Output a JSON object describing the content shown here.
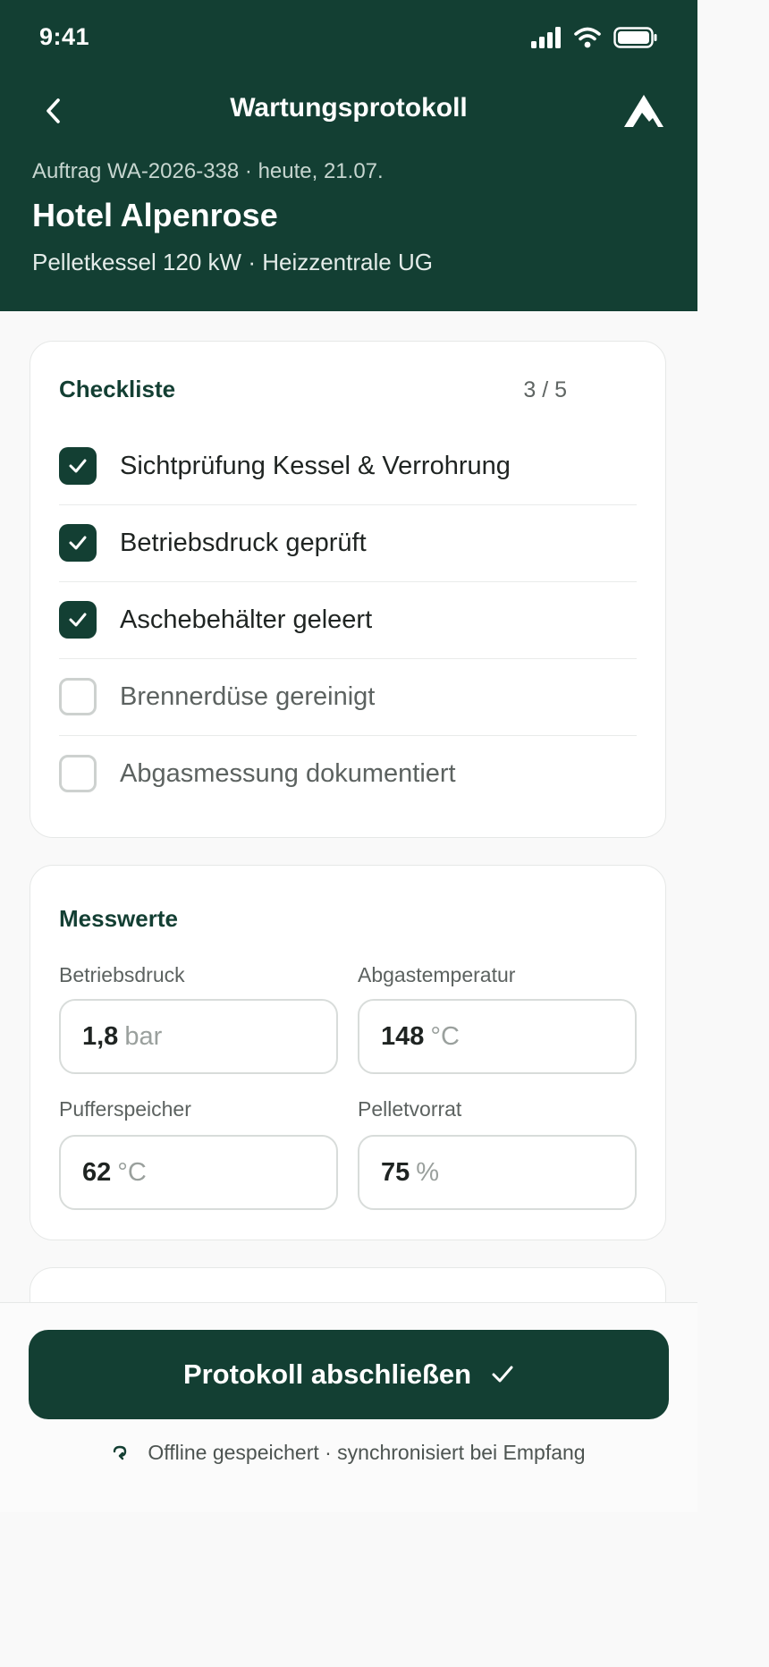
{
  "status_bar": {
    "time": "9:41"
  },
  "nav": {
    "title": "Wartungsprotokoll"
  },
  "job": {
    "order_line": "Auftrag WA-2026-338 · heute, 21.07.",
    "customer": "Hotel Alpenrose",
    "device": "Pelletkessel 120 kW · Heizzentrale UG"
  },
  "checklist": {
    "title": "Checkliste",
    "count": "3 / 5",
    "items": [
      {
        "label": "Sichtprüfung Kessel & Verrohrung",
        "checked": true
      },
      {
        "label": "Betriebsdruck geprüft",
        "checked": true
      },
      {
        "label": "Aschebehälter geleert",
        "checked": true
      },
      {
        "label": "Brennerdüse gereinigt",
        "checked": false
      },
      {
        "label": "Abgasmessung dokumentiert",
        "checked": false
      }
    ]
  },
  "measurements": {
    "title": "Messwerte",
    "fields": [
      {
        "label": "Betriebsdruck",
        "value": "1,8",
        "unit": "bar"
      },
      {
        "label": "Abgastemperatur",
        "value": "148",
        "unit": "°C"
      },
      {
        "label": "Pufferspeicher",
        "value": "62",
        "unit": "°C"
      },
      {
        "label": "Pelletvorrat",
        "value": "75",
        "unit": "%"
      }
    ]
  },
  "footer": {
    "complete_label": "Protokoll abschließen",
    "offline_note": "Offline gespeichert · synchronisiert bei Empfang"
  },
  "colors": {
    "primary": "#133f33",
    "surface": "#ffffff",
    "background": "#f9f9f9"
  }
}
